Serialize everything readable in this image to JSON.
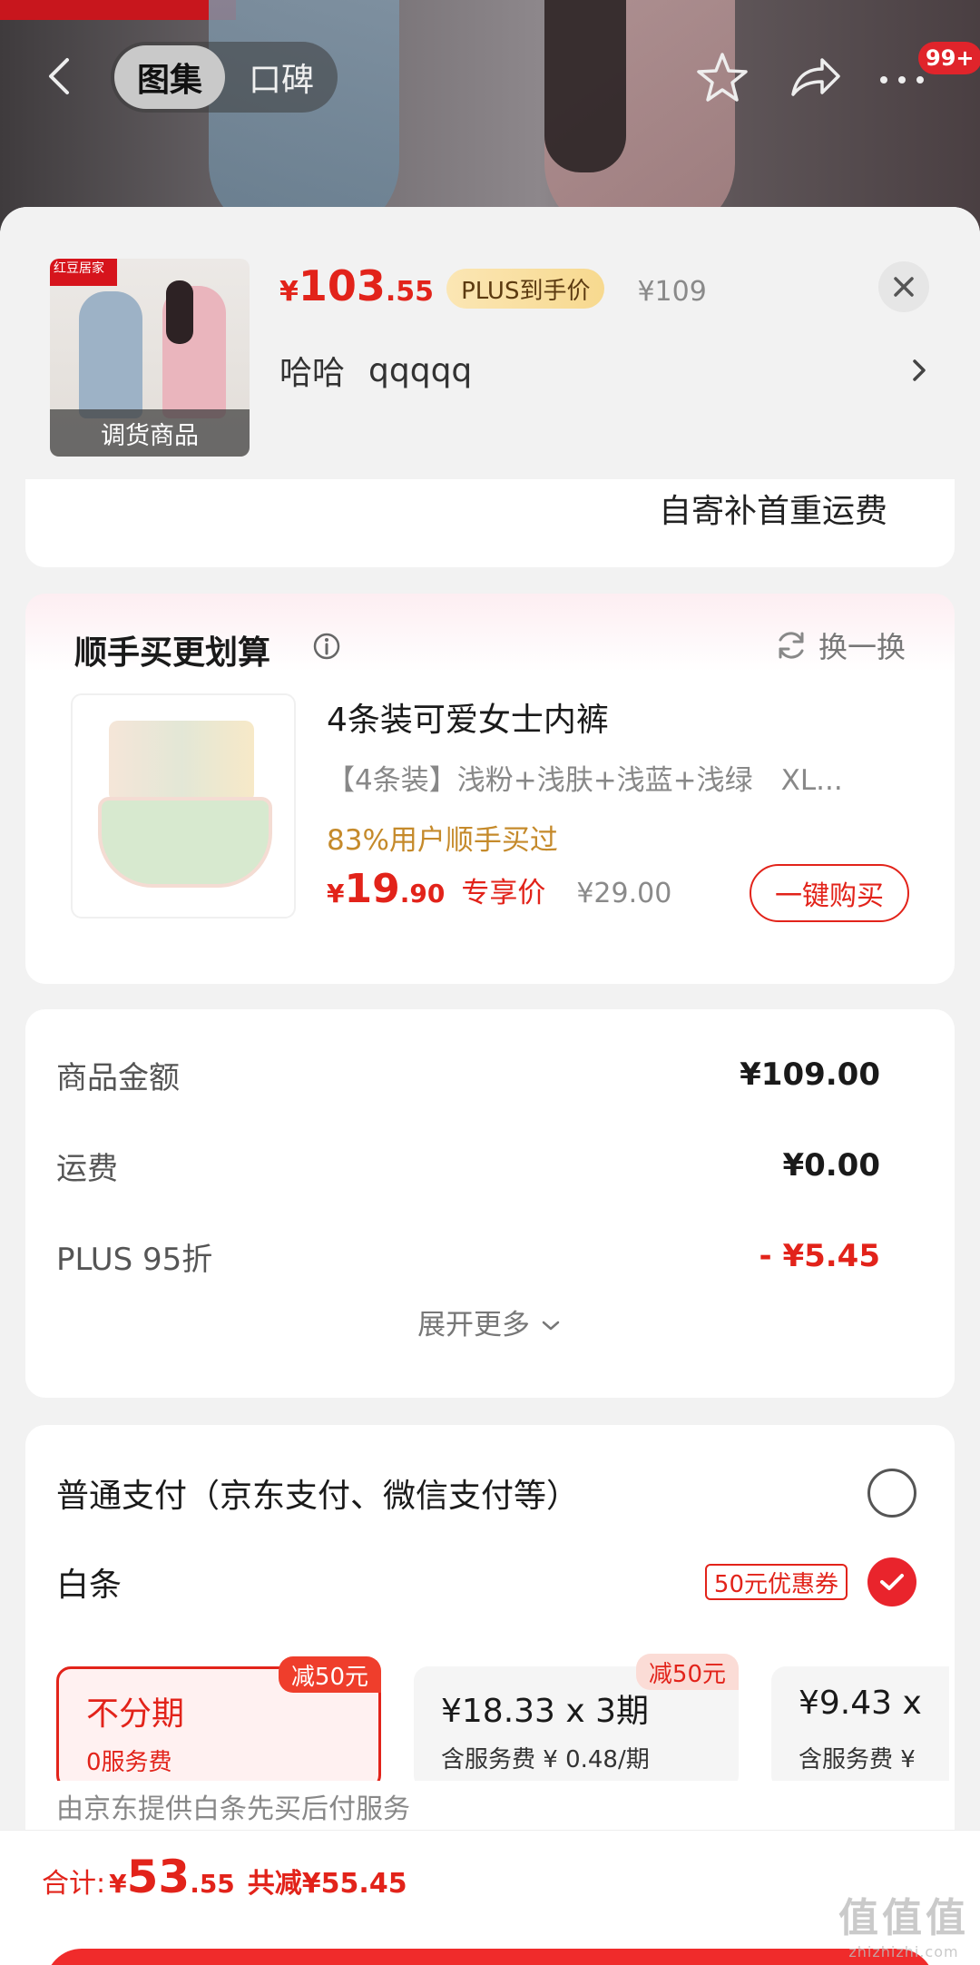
{
  "top_nav": {
    "tabs": [
      "图集",
      "口碑"
    ],
    "active_tab": 0,
    "cart_badge": "99+"
  },
  "product": {
    "thumb_tag": "红豆居家",
    "thumb_caption": "调货商品",
    "price_symbol": "¥",
    "price_int": "103",
    "price_dec": ".55",
    "plus_tag": "PLUS到手价",
    "orig_price": "¥109",
    "spec_label": "哈哈",
    "spec_value": "qqqqq"
  },
  "shipping": {
    "text": "自寄补首重运费"
  },
  "bundle": {
    "title": "顺手买更划算",
    "swap_label": "换一换",
    "name": "4条装可爱女士内裤",
    "sku": "【4条装】浅粉+浅肤+浅蓝+浅绿　XL...",
    "bought": "83%用户顺手买过",
    "price_symbol": "¥",
    "price_int": "19",
    "price_dec": ".90",
    "exclusive": "专享价",
    "orig_price": "¥29.00",
    "buy_label": "一键购买"
  },
  "summary": {
    "rows": [
      {
        "label": "商品金额",
        "value": "¥109.00"
      },
      {
        "label": "运费",
        "value": "¥0.00"
      },
      {
        "label": "PLUS 95折",
        "value": "- ¥5.45"
      }
    ],
    "expand_label": "展开更多"
  },
  "payment": {
    "normal_label": "普通支付（京东支付、微信支付等）",
    "baitiao_label": "白条",
    "coupon": "50元优惠券",
    "plans": [
      {
        "title": "不分期",
        "sub": "0服务费",
        "tag": "减50元",
        "selected": true
      },
      {
        "title": "¥18.33 x 3期",
        "sub": "含服务费 ¥ 0.48/期",
        "tag": "减50元",
        "selected": false
      },
      {
        "title": "¥9.43 x",
        "sub": "含服务费 ¥",
        "tag": "",
        "selected": false
      }
    ],
    "note": "由京东提供白条先买后付服务"
  },
  "footer": {
    "total_label": "合计:",
    "total_symbol": "¥",
    "total_int": "53",
    "total_dec": ".55",
    "total_off": "共减¥55.45"
  },
  "watermark": {
    "big": "值值值",
    "small": "zhizhizhi.com"
  },
  "colors": {
    "accent": "#e2231a",
    "plus_gold": "#f7d98f"
  }
}
